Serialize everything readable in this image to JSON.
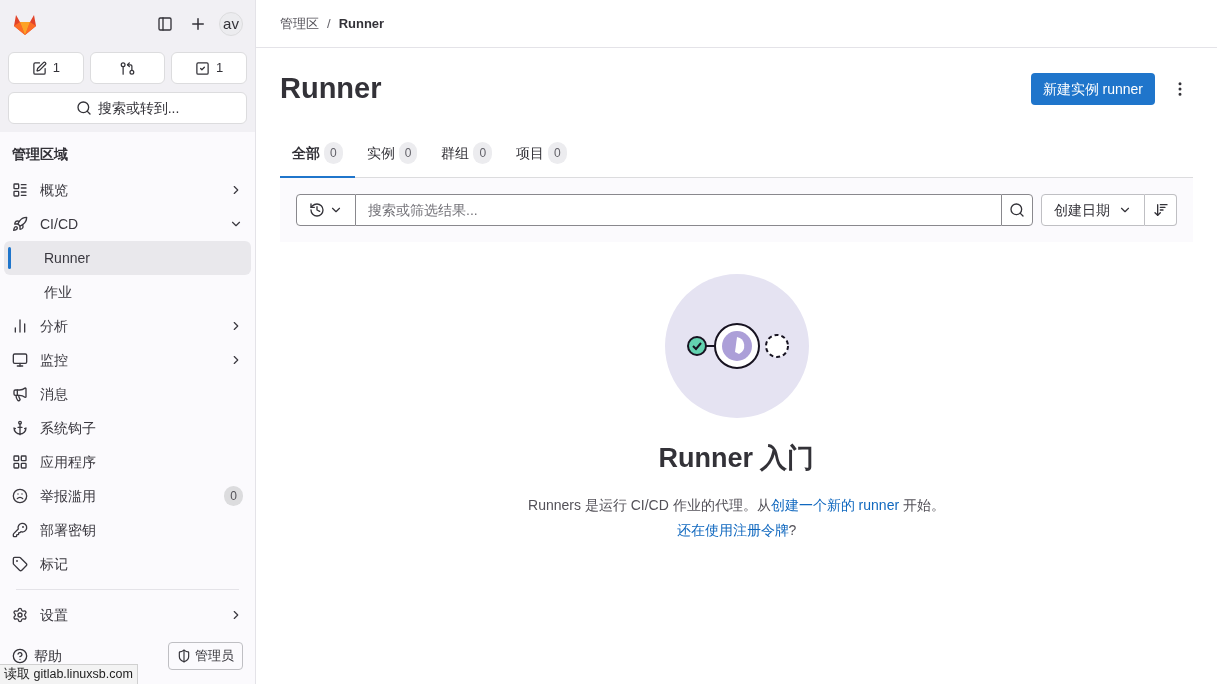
{
  "top_bar": {
    "avatar": "av"
  },
  "counters": [
    {
      "kind": "issues",
      "count": "1"
    },
    {
      "kind": "merge_requests"
    },
    {
      "kind": "todos",
      "count": "1"
    }
  ],
  "search_button": {
    "label": "搜索或转到..."
  },
  "sidebar": {
    "heading": "管理区域",
    "items": [
      {
        "label": "概览",
        "kind": "nav",
        "expanded": false
      },
      {
        "label": "CI/CD",
        "kind": "nav",
        "expanded": true,
        "children": [
          {
            "label": "Runner",
            "selected": true
          },
          {
            "label": "作业",
            "selected": false
          }
        ]
      },
      {
        "label": "分析",
        "kind": "nav",
        "expanded": false
      },
      {
        "label": "监控",
        "kind": "nav",
        "expanded": false
      },
      {
        "label": "消息",
        "kind": "nav"
      },
      {
        "label": "系统钩子",
        "kind": "nav"
      },
      {
        "label": "应用程序",
        "kind": "nav"
      },
      {
        "label": "举报滥用",
        "kind": "nav",
        "badge": "0"
      },
      {
        "label": "部署密钥",
        "kind": "nav"
      },
      {
        "label": "标记",
        "kind": "nav"
      },
      {
        "kind": "divider"
      },
      {
        "label": "设置",
        "kind": "nav",
        "expanded": false
      }
    ],
    "footer": {
      "help": "帮助",
      "admin": "管理员"
    }
  },
  "breadcrumb": [
    "管理区",
    "Runner"
  ],
  "breadcrumb_separator": "/",
  "page_title": "Runner",
  "new_button": "新建实例 runner",
  "tabs": [
    {
      "label": "全部",
      "count": "0",
      "selected": true
    },
    {
      "label": "实例",
      "count": "0",
      "selected": false
    },
    {
      "label": "群组",
      "count": "0",
      "selected": false
    },
    {
      "label": "项目",
      "count": "0",
      "selected": false
    }
  ],
  "filter": {
    "placeholder": "搜索或筛选结果...",
    "sort": "创建日期"
  },
  "empty_state": {
    "title": "Runner 入门",
    "text_before": "Runners 是运行 CI/CD 作业的代理。从",
    "link": "创建一个新的 runner",
    "text_after": " 开始。",
    "token_link": "还在使用注册令牌",
    "token_after": "?"
  },
  "status_bar": "读取 gitlab.linuxsb.com"
}
